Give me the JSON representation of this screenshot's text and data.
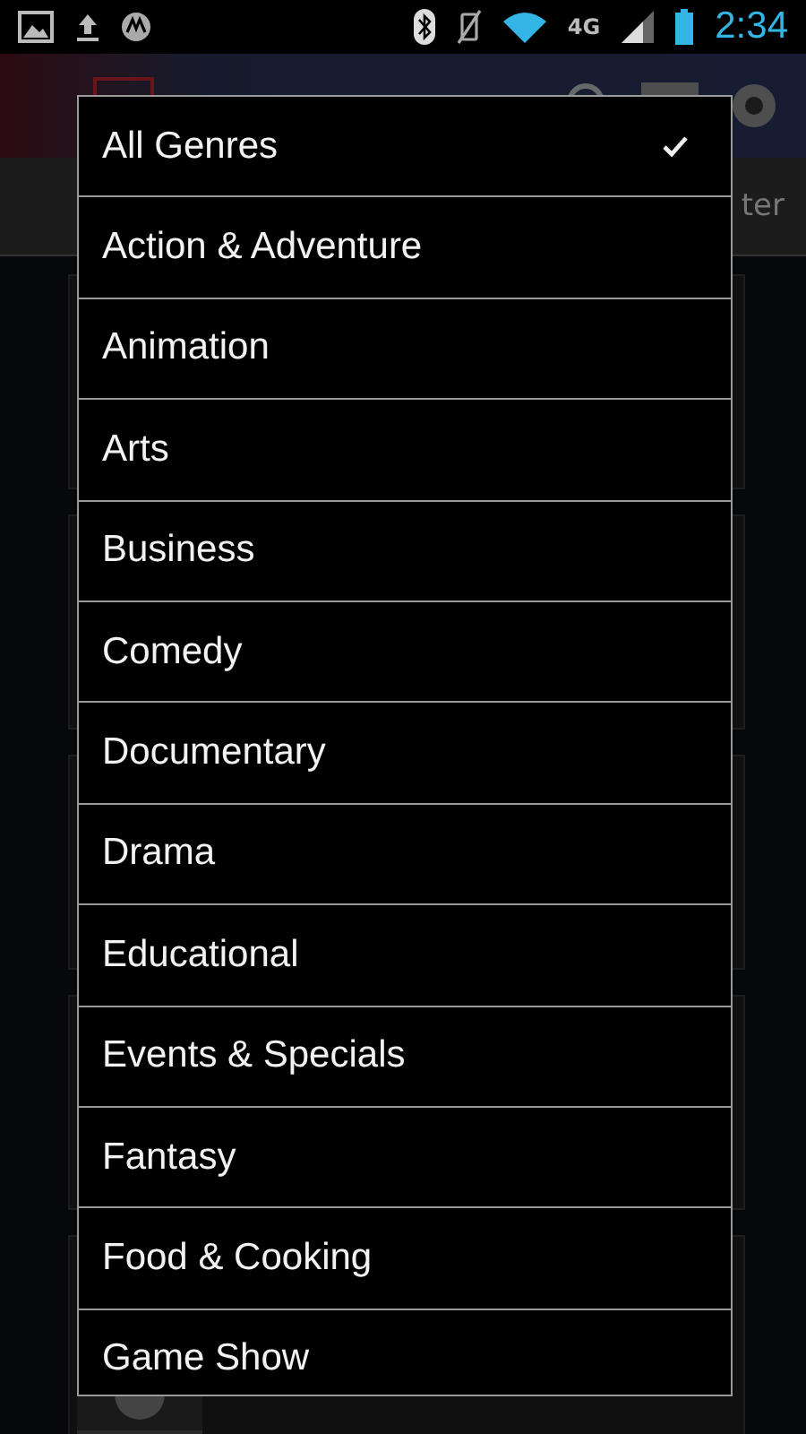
{
  "status_bar": {
    "network": "4G",
    "time": "2:34"
  },
  "background": {
    "filter_tab": "ter"
  },
  "genre_menu": {
    "items": [
      {
        "label": "All Genres",
        "selected": true
      },
      {
        "label": "Action & Adventure",
        "selected": false
      },
      {
        "label": "Animation",
        "selected": false
      },
      {
        "label": "Arts",
        "selected": false
      },
      {
        "label": "Business",
        "selected": false
      },
      {
        "label": "Comedy",
        "selected": false
      },
      {
        "label": "Documentary",
        "selected": false
      },
      {
        "label": "Drama",
        "selected": false
      },
      {
        "label": "Educational",
        "selected": false
      },
      {
        "label": "Events & Specials",
        "selected": false
      },
      {
        "label": "Fantasy",
        "selected": false
      },
      {
        "label": "Food & Cooking",
        "selected": false
      },
      {
        "label": "Game Show",
        "selected": false
      }
    ]
  }
}
